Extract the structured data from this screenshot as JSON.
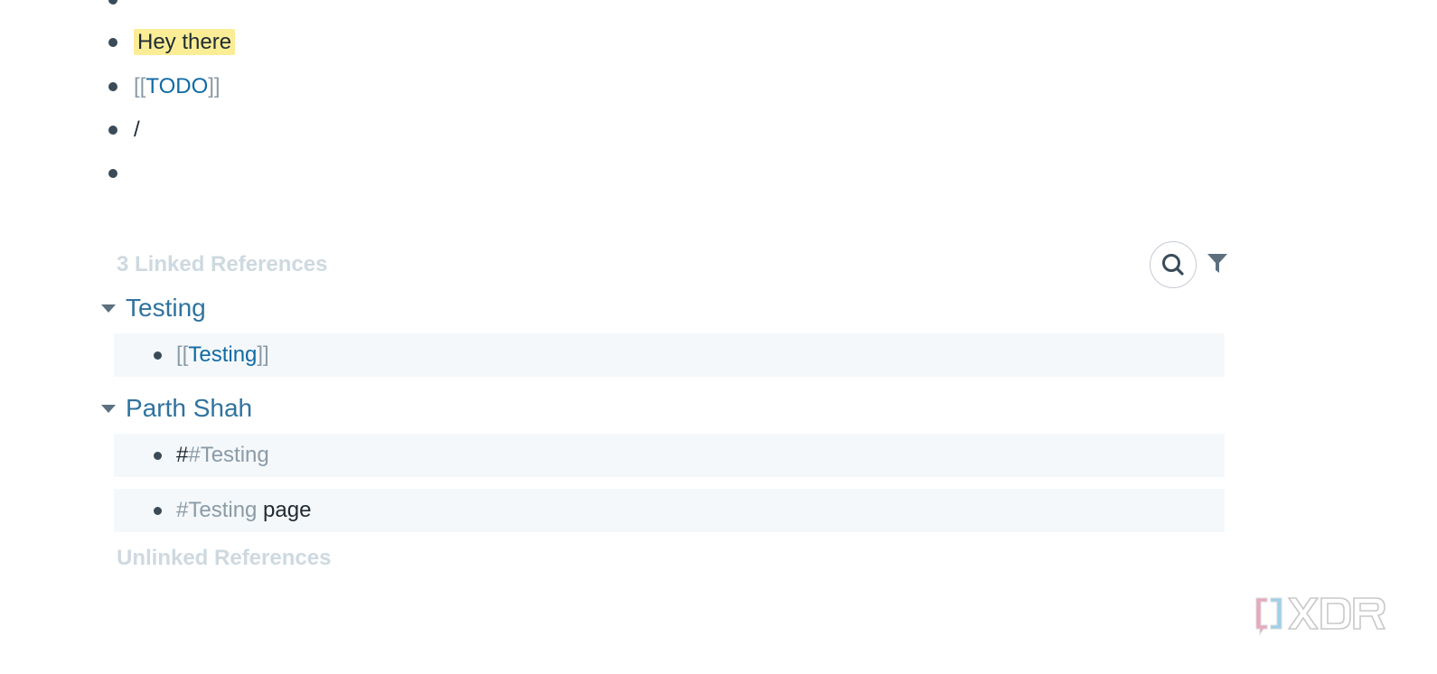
{
  "blocks": [
    {
      "text": ""
    },
    {
      "text": "Hey there"
    },
    {
      "bracket_open": "[[",
      "link": "TODO",
      "bracket_close": "]]"
    },
    {
      "text": "/"
    },
    {
      "text": ""
    }
  ],
  "linked_references": {
    "title": "3 Linked References",
    "groups": [
      {
        "page_title": "Testing",
        "items": [
          {
            "bracket_open": "[[",
            "link": "Testing",
            "bracket_close": "]]"
          }
        ]
      },
      {
        "page_title": "Parth Shah",
        "items": [
          {
            "prefix": "#",
            "tag": "#Testing",
            "suffix": ""
          },
          {
            "prefix": "",
            "tag": "#Testing",
            "suffix": " page"
          }
        ]
      }
    ]
  },
  "unlinked_references": {
    "title": "Unlinked References"
  },
  "icons": {
    "search": "search-icon",
    "filter": "filter-icon",
    "caret": "caret-down-icon"
  },
  "watermark": {
    "brand": "XDA"
  },
  "colors": {
    "highlight": "#fbed96",
    "link": "#106ba3",
    "page_title": "#30739e",
    "muted": "#8a9ba8",
    "section_title": "#ced9e0",
    "card_bg": "#f5f8fa"
  }
}
